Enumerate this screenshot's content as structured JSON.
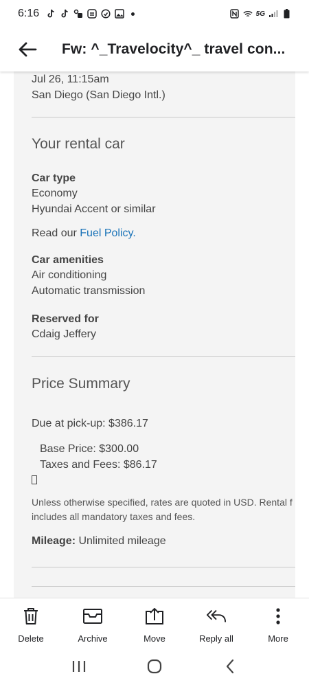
{
  "status_bar": {
    "time": "6:16",
    "network": "5G"
  },
  "app_bar": {
    "title": "Fw: ^_Travelocity^_ travel con..."
  },
  "pickup": {
    "datetime": "Jul 26, 11:15am",
    "location": "San Diego (San Diego Intl.)"
  },
  "rental": {
    "heading": "Your rental car",
    "car_type_label": "Car type",
    "car_class": "Economy",
    "car_model": "Hyundai Accent or similar",
    "fuel_prefix": "Read our ",
    "fuel_link": "Fuel Policy.",
    "amenities_label": "Car amenities",
    "amenities": [
      "Air conditioning",
      "Automatic transmission"
    ],
    "reserved_label": "Reserved for",
    "reserved_name": "Cdaig Jeffery"
  },
  "price": {
    "heading": "Price Summary",
    "due": "Due at pick-up: $386.17",
    "base": "Base Price: $300.00",
    "taxes": "Taxes and Fees: $86.17",
    "note_line1": "Unless otherwise specified, rates are quoted in USD. Rental f",
    "note_line2": "includes all mandatory taxes and fees.",
    "mileage_label": "Mileage:",
    "mileage_value": " Unlimited mileage"
  },
  "toolbar": {
    "items": [
      {
        "label": "Delete",
        "icon": "trash-icon"
      },
      {
        "label": "Archive",
        "icon": "archive-icon"
      },
      {
        "label": "Move",
        "icon": "move-icon"
      },
      {
        "label": "Reply all",
        "icon": "reply-all-icon"
      },
      {
        "label": "More",
        "icon": "more-vertical-icon"
      }
    ]
  },
  "colors": {
    "link": "#1a73b8",
    "email_bg": "#f4f4f4",
    "text": "#444444"
  }
}
